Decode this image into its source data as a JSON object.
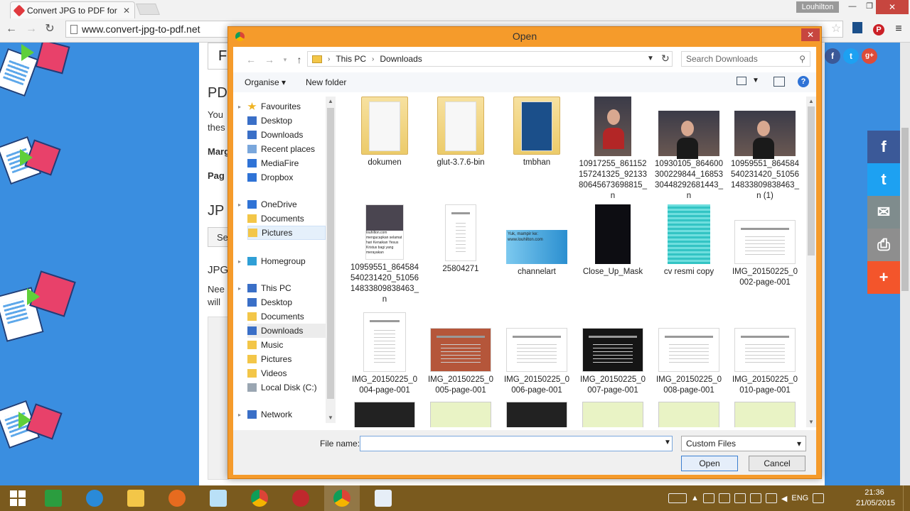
{
  "browser": {
    "tab_title": "Convert JPG to PDF for free",
    "tab_close": "✕",
    "url": "www.convert-jpg-to-pdf.net",
    "window_user": "Louhilton"
  },
  "page": {
    "labels": [
      "F",
      "PD",
      "You",
      "thes",
      "Marg",
      "Pag",
      "JP",
      "Se",
      "JPG",
      "Nee",
      "will"
    ]
  },
  "dialog": {
    "title": "Open",
    "breadcrumb": [
      "This PC",
      "Downloads"
    ],
    "search_placeholder": "Search Downloads",
    "toolbar": {
      "organise": "Organise",
      "new_folder": "New folder"
    },
    "nav": [
      {
        "label": "Favourites",
        "type": "group"
      },
      {
        "label": "Desktop",
        "type": "item"
      },
      {
        "label": "Downloads",
        "type": "item"
      },
      {
        "label": "Recent places",
        "type": "item"
      },
      {
        "label": "MediaFire",
        "type": "item"
      },
      {
        "label": "Dropbox",
        "type": "item"
      },
      {
        "label": "OneDrive",
        "type": "group"
      },
      {
        "label": "Documents",
        "type": "item"
      },
      {
        "label": "Pictures",
        "type": "item",
        "selected": true
      },
      {
        "label": "Homegroup",
        "type": "group"
      },
      {
        "label": "This PC",
        "type": "group"
      },
      {
        "label": "Desktop",
        "type": "item"
      },
      {
        "label": "Documents",
        "type": "item"
      },
      {
        "label": "Downloads",
        "type": "item",
        "selected2": true
      },
      {
        "label": "Music",
        "type": "item"
      },
      {
        "label": "Pictures",
        "type": "item"
      },
      {
        "label": "Videos",
        "type": "item"
      },
      {
        "label": "Local Disk (C:)",
        "type": "item"
      },
      {
        "label": "Network",
        "type": "group"
      }
    ],
    "files": [
      {
        "name": "dokumen",
        "kind": "folder"
      },
      {
        "name": "glut-3.7.6-bin",
        "kind": "folder"
      },
      {
        "name": "tmbhan",
        "kind": "folder-blue"
      },
      {
        "name": "10917255_861152157241325_9213380645673698815_n",
        "kind": "photo-tall"
      },
      {
        "name": "10930105_864600300229844_1685330448292681443_n",
        "kind": "photo"
      },
      {
        "name": "10959551_864584540231420_5105614833809838463_n (1)",
        "kind": "photo"
      },
      {
        "name": "10959551_864584540231420_5105614833809838463_n",
        "kind": "card"
      },
      {
        "name": "25804271",
        "kind": "doc"
      },
      {
        "name": "channelart",
        "kind": "banner"
      },
      {
        "name": "Close_Up_Mask",
        "kind": "dark"
      },
      {
        "name": "cv resmi copy",
        "kind": "cyan"
      },
      {
        "name": "IMG_20150225_0002-page-001",
        "kind": "cert"
      },
      {
        "name": "IMG_20150225_0004-page-001",
        "kind": "cert-tall"
      },
      {
        "name": "IMG_20150225_0005-page-001",
        "kind": "cert-red"
      },
      {
        "name": "IMG_20150225_0006-page-001",
        "kind": "cert"
      },
      {
        "name": "IMG_20150225_0007-page-001",
        "kind": "cert-dark"
      },
      {
        "name": "IMG_20150225_0008-page-001",
        "kind": "cert"
      },
      {
        "name": "IMG_20150225_0010-page-001",
        "kind": "cert"
      }
    ],
    "card_text": "louhilton.com mengucapkan selamat hari Kenaikan Yesus Kristus bagi yang merayakan",
    "banner_text": "Yuk, mampir ke: www.louhilton.com",
    "file_name_label": "File name:",
    "file_name_value": "",
    "file_type": "Custom Files",
    "open_label": "Open",
    "cancel_label": "Cancel"
  },
  "social_right": [
    "f",
    "t",
    "✉",
    "⎙",
    "+"
  ],
  "taskbar": {
    "lang": "ENG",
    "time": "21:36",
    "date": "21/05/2015"
  },
  "colors": {
    "dialog_frame": "#f59b2b",
    "taskbar": "#7a5a1e",
    "page_bg": "#3a8ee0",
    "facebook": "#3b5998",
    "twitter": "#1da1f2",
    "mail": "#7f8c8d",
    "print": "#8e8e8e",
    "plus": "#f3552b"
  }
}
